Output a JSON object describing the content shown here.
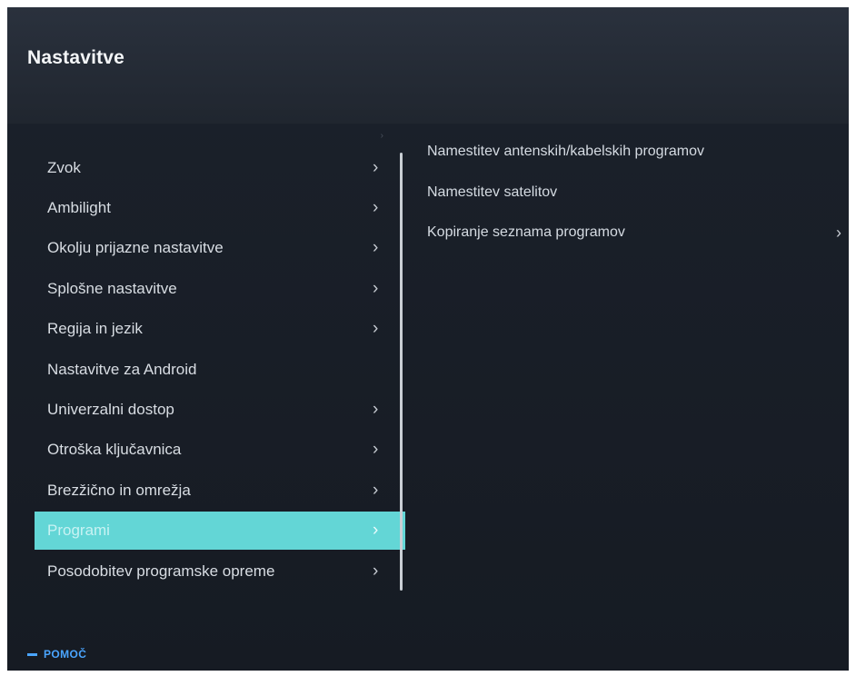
{
  "app": {
    "title": "Nastavitve"
  },
  "left_menu": {
    "items": [
      {
        "label": "Zvok",
        "has_submenu": true
      },
      {
        "label": "Ambilight",
        "has_submenu": true
      },
      {
        "label": "Okolju prijazne nastavitve",
        "has_submenu": true
      },
      {
        "label": "Splošne nastavitve",
        "has_submenu": true
      },
      {
        "label": "Regija in jezik",
        "has_submenu": true
      },
      {
        "label": "Nastavitve za Android",
        "has_submenu": false
      },
      {
        "label": "Univerzalni dostop",
        "has_submenu": true
      },
      {
        "label": "Otroška ključavnica",
        "has_submenu": true
      },
      {
        "label": "Brezžično in omrežja",
        "has_submenu": true
      },
      {
        "label": "Programi",
        "has_submenu": true,
        "selected": true
      },
      {
        "label": "Posodobitev programske opreme",
        "has_submenu": true
      }
    ],
    "chevron_glyph": "›",
    "selection_color": "#63d6d6"
  },
  "right_menu": {
    "items": [
      {
        "label": "Namestitev antenskih/kabelskih programov",
        "has_submenu": false
      },
      {
        "label": "Namestitev satelitov",
        "has_submenu": false
      },
      {
        "label": "Kopiranje seznama programov",
        "has_submenu": true
      }
    ]
  },
  "footer": {
    "help_label": "POMOČ",
    "help_color": "#4aa5ff"
  }
}
